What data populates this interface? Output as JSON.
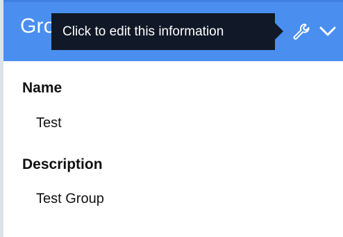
{
  "header": {
    "title": "Group Information",
    "edit_icon": "wrench-icon",
    "collapse_icon": "chevron-down-icon"
  },
  "tooltip": {
    "text": "Click to edit this information"
  },
  "fields": {
    "name": {
      "label": "Name",
      "value": "Test"
    },
    "description": {
      "label": "Description",
      "value": "Test Group"
    }
  },
  "colors": {
    "header_bg": "#4a8ff0",
    "tooltip_bg": "#111827",
    "text": "#111111"
  }
}
